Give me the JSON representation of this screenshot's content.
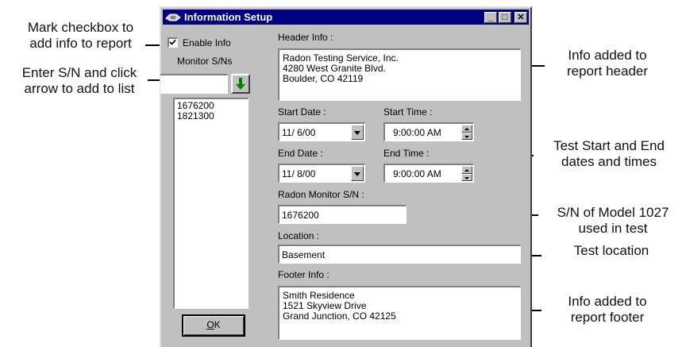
{
  "annotations": {
    "checkbox_note": "Mark checkbox to\nadd info to report",
    "serial_note": "Enter S/N and click\narrow to add to list",
    "header_note": "Info added to\nreport header",
    "dates_note": "Test Start and End\ndates and times",
    "monitor_note": "S/N of Model 1027\nused in test",
    "location_note": "Test location",
    "footer_note": "Info added to\nreport footer"
  },
  "window": {
    "title": "Information Setup",
    "minimize_glyph": "_",
    "maximize_glyph": "□",
    "close_glyph": "✕"
  },
  "left_panel": {
    "enable_label": "Enable Info",
    "enable_checked": true,
    "monitor_sns_label": "Monitor S/Ns",
    "sn_input_value": "",
    "add_arrow_icon": "green-down-arrow",
    "sn_list": [
      "1676200",
      "1821300"
    ],
    "ok_label_prefix": "O",
    "ok_label_rest": "K"
  },
  "form": {
    "header_label": "Header Info :",
    "header_value": "Radon Testing Service, Inc.\n4280 West Granite Blvd.\nBoulder, CO 42119",
    "start_date_label": "Start Date :",
    "start_date_value": "11/ 6/00",
    "start_time_label": "Start Time :",
    "start_time_value": "9:00:00 AM",
    "end_date_label": "End Date :",
    "end_date_value": "11/ 8/00",
    "end_time_label": "End Time :",
    "end_time_value": "9:00:00 AM",
    "radon_sn_label": "Radon Monitor S/N :",
    "radon_sn_value": "1676200",
    "location_label": "Location :",
    "location_value": "Basement",
    "footer_label": "Footer Info :",
    "footer_value": "Smith Residence\n1521 Skyview Drive\nGrand Junction, CO 42125"
  },
  "colors": {
    "title_bar": "#000080",
    "window_face": "#c0c0c0",
    "arrow_green": "#008000"
  }
}
